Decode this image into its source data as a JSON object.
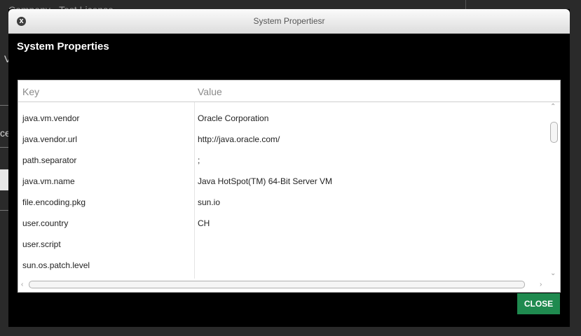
{
  "background": {
    "title": "Company - Test License",
    "fragments": [
      "V",
      "ce"
    ]
  },
  "dialog": {
    "window_title": "System Propertiesr",
    "heading": "System Properties",
    "columns": {
      "key": "Key",
      "value": "Value"
    },
    "rows": [
      {
        "key": "java.vm.vendor",
        "value": "Oracle Corporation"
      },
      {
        "key": "java.vendor.url",
        "value": "http://java.oracle.com/"
      },
      {
        "key": "path.separator",
        "value": ";"
      },
      {
        "key": "java.vm.name",
        "value": "Java HotSpot(TM) 64-Bit Server VM"
      },
      {
        "key": "file.encoding.pkg",
        "value": "sun.io"
      },
      {
        "key": "user.country",
        "value": "CH"
      },
      {
        "key": "user.script",
        "value": ""
      },
      {
        "key": "sun.os.patch.level",
        "value": ""
      }
    ],
    "close_label": "CLOSE",
    "close_icon": "x",
    "accent_color": "#1f8a4f"
  }
}
